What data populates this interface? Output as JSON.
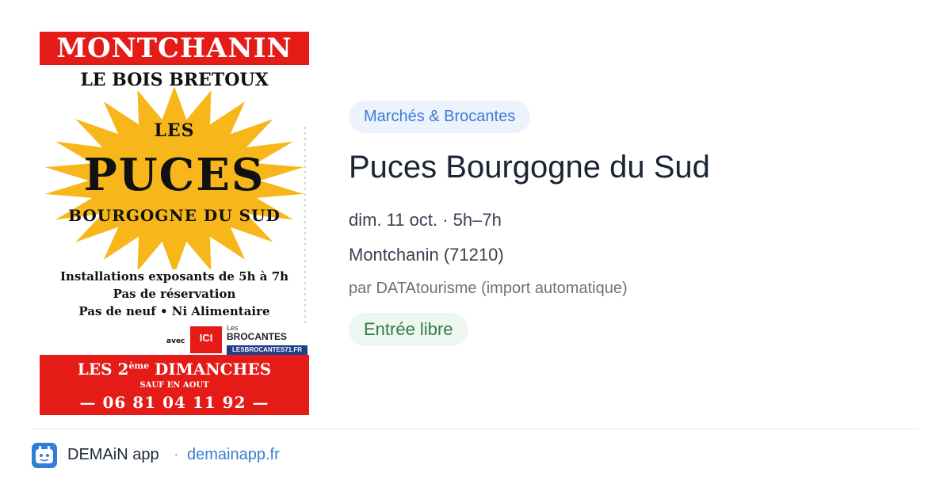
{
  "poster": {
    "top_banner": "MONTCHANIN",
    "subtitle": "LE BOIS BRETOUX",
    "star_les": "LES",
    "star_puces": "PUCES",
    "star_region": "BOURGOGNE DU SUD",
    "info_line1": "Installations exposants de 5h à 7h",
    "info_line2": "Pas de réservation",
    "info_line3": "Pas de neuf • Ni Alimentaire",
    "logo_avec": "avec",
    "logo_ici": "ICI",
    "logo_les": "Les",
    "logo_brocantes": "BROCANTES",
    "logo_url": "LESBROCANTES71.FR",
    "bottom_line1_pre": "LES 2",
    "bottom_line1_sup": "ème",
    "bottom_line1_post": " DIMANCHES",
    "bottom_line2": "SAUF EN AOUT",
    "bottom_line3": "— 06 81 04 11 92 —",
    "colors": {
      "red": "#e41b17",
      "star": "#f7b71a",
      "blue": "#1e3f8a"
    }
  },
  "event": {
    "category": "Marchés & Brocantes",
    "title": "Puces Bourgogne du Sud",
    "datetime": "dim. 11 oct. · 5h–7h",
    "location": "Montchanin (71210)",
    "source": "par DATAtourisme (import automatique)",
    "price": "Entrée libre"
  },
  "footer": {
    "app_icon": "app-logo-icon",
    "app_name": "DEMAiN app",
    "separator": "·",
    "url": "demainapp.fr"
  },
  "colors": {
    "accent_blue": "#3a7bd5",
    "pill_blue_bg": "#edf3fc",
    "pill_green_bg": "#edf7ef",
    "green_text": "#2f7d46",
    "title": "#1b2432"
  }
}
